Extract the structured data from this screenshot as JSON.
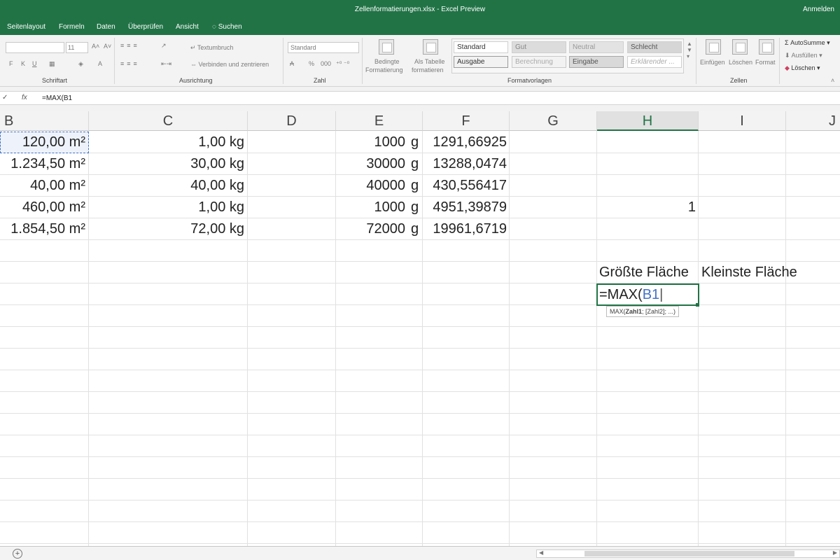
{
  "window": {
    "title": "Zellenformatierungen.xlsx  -  Excel Preview",
    "signin": "Anmelden"
  },
  "tabs": [
    "Seitenlayout",
    "Formeln",
    "Daten",
    "Überprüfen",
    "Ansicht",
    "Suchen"
  ],
  "ribbon": {
    "font_size": "11",
    "font_buttons": [
      "F",
      "K",
      "U"
    ],
    "font_group": "Schriftart",
    "wrap_text": "Textumbruch",
    "merge_center": "Verbinden und zentrieren",
    "align_group": "Ausrichtung",
    "number_format": "Standard",
    "number_group": "Zahl",
    "cond_format": [
      "Bedingte",
      "Formatierung"
    ],
    "as_table": [
      "Als Tabelle",
      "formatieren"
    ],
    "styles": [
      "Standard",
      "Gut",
      "Neutral",
      "Schlecht",
      "Ausgabe",
      "Berechnung",
      "Eingabe",
      "Erklärender ..."
    ],
    "styles_group": "Formatvorlagen",
    "cells_buttons": [
      "Einfügen",
      "Löschen",
      "Format"
    ],
    "cells_group": "Zellen",
    "autosum": "AutoSumme",
    "fill": "Ausfüllen",
    "clear": "Löschen"
  },
  "formula_bar": {
    "check": "✓",
    "fx": "fx",
    "formula": "=MAX(B1"
  },
  "columns": [
    "B",
    "C",
    "D",
    "E",
    "F",
    "G",
    "H",
    "I",
    "J"
  ],
  "rows": [
    {
      "b": "120,00 m²",
      "c": "1,00 kg",
      "e": "1000",
      "e_unit": "g",
      "f": "1291,66925",
      "h": ""
    },
    {
      "b": "1.234,50 m²",
      "c": "30,00 kg",
      "e": "30000",
      "e_unit": "g",
      "f": "13288,0474",
      "h": ""
    },
    {
      "b": "40,00 m²",
      "c": "40,00 kg",
      "e": "40000",
      "e_unit": "g",
      "f": "430,556417",
      "h": ""
    },
    {
      "b": "460,00 m²",
      "c": "1,00 kg",
      "e": "1000",
      "e_unit": "g",
      "f": "4951,39879",
      "h": "1"
    },
    {
      "b": "1.854,50 m²",
      "c": "72,00 kg",
      "e": "72000",
      "e_unit": "g",
      "f": "19961,6719",
      "h": ""
    }
  ],
  "labels": {
    "h7": "Größte Fläche",
    "i7": "Kleinste Fläche"
  },
  "editing": {
    "prefix": "=MAX(",
    "ref": "B1",
    "tooltip_fn": "MAX(",
    "tooltip_arg": "Zahl1",
    "tooltip_rest": "; [Zahl2]; ...)"
  },
  "colors": {
    "accent": "#217346",
    "ref": "#4472c4"
  }
}
